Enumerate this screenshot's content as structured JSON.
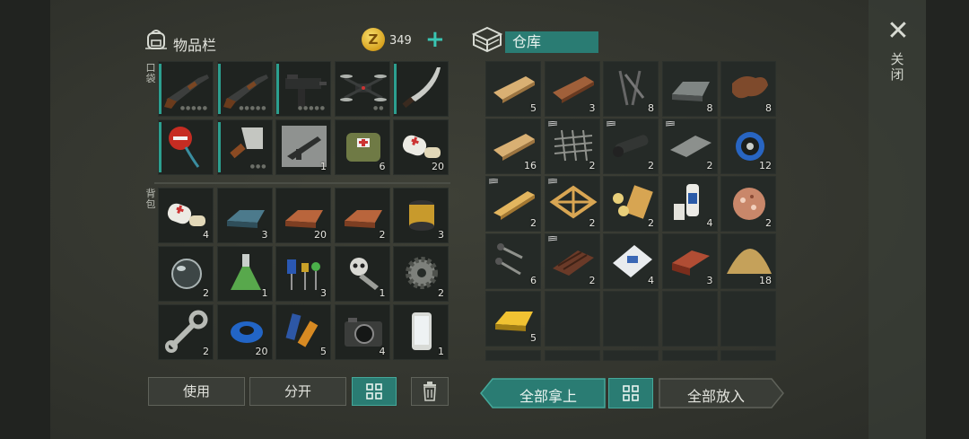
{
  "inventory": {
    "title": "物品栏",
    "coins": "349",
    "add_symbol": "+",
    "pocket_label": "口袋",
    "backpack_label": "背包",
    "pocket_items": [
      {
        "name": "pump-shotgun",
        "count": "",
        "durability": true,
        "dots": "●●●●●"
      },
      {
        "name": "pump-shotgun-2",
        "count": "",
        "durability": true,
        "dots": "●●●●●"
      },
      {
        "name": "uzi-smg",
        "count": "",
        "durability": true,
        "dots": "●●●●●"
      },
      {
        "name": "drone",
        "count": "",
        "durability": false,
        "dots": "●●"
      },
      {
        "name": "machete",
        "count": "",
        "durability": true,
        "dots": ""
      },
      {
        "name": "stop-sign-axe",
        "count": "",
        "durability": true,
        "dots": ""
      },
      {
        "name": "cleaver",
        "count": "",
        "durability": true,
        "dots": "●●●"
      },
      {
        "name": "rifle-blueprint",
        "count": "1",
        "durability": false,
        "dots": ""
      },
      {
        "name": "first-aid-backpack",
        "count": "6",
        "durability": false,
        "dots": ""
      },
      {
        "name": "bandage",
        "count": "20",
        "durability": false,
        "dots": ""
      }
    ],
    "backpack_items": [
      {
        "name": "bandage",
        "count": "4"
      },
      {
        "name": "steel-ingot",
        "count": "3"
      },
      {
        "name": "copper-ingot",
        "count": "20"
      },
      {
        "name": "copper-ingot",
        "count": "2"
      },
      {
        "name": "oil-filter",
        "count": "3"
      },
      {
        "name": "glass-lens",
        "count": "2"
      },
      {
        "name": "chemical-flask",
        "count": "1"
      },
      {
        "name": "capacitors",
        "count": "3"
      },
      {
        "name": "skull-mechanism",
        "count": "1"
      },
      {
        "name": "gear",
        "count": "2"
      },
      {
        "name": "wrench",
        "count": "2"
      },
      {
        "name": "duct-tape",
        "count": "20"
      },
      {
        "name": "batteries",
        "count": "5"
      },
      {
        "name": "camera",
        "count": "4"
      },
      {
        "name": "smartphone",
        "count": "1"
      }
    ]
  },
  "storage": {
    "title": "仓库",
    "items": [
      {
        "name": "plank",
        "count": "5",
        "blueprint": false
      },
      {
        "name": "dark-plank",
        "count": "3",
        "blueprint": false
      },
      {
        "name": "nails",
        "count": "8",
        "blueprint": false
      },
      {
        "name": "iron-ingot",
        "count": "8",
        "blueprint": false
      },
      {
        "name": "leather",
        "count": "8",
        "blueprint": false
      },
      {
        "name": "plank",
        "count": "16",
        "blueprint": false
      },
      {
        "name": "rebar-grid",
        "count": "2",
        "blueprint": true
      },
      {
        "name": "pipe",
        "count": "2",
        "blueprint": true
      },
      {
        "name": "metal-plate",
        "count": "2",
        "blueprint": true
      },
      {
        "name": "wire-spool",
        "count": "12",
        "blueprint": false
      },
      {
        "name": "beam",
        "count": "2",
        "blueprint": true
      },
      {
        "name": "wood-frame",
        "count": "2",
        "blueprint": true
      },
      {
        "name": "wood-bolts",
        "count": "2",
        "blueprint": false
      },
      {
        "name": "glue-bottles",
        "count": "4",
        "blueprint": false
      },
      {
        "name": "wood-shavings",
        "count": "2",
        "blueprint": false
      },
      {
        "name": "screws",
        "count": "6",
        "blueprint": false
      },
      {
        "name": "roof-tiles",
        "count": "2",
        "blueprint": true
      },
      {
        "name": "cement-bag",
        "count": "4",
        "blueprint": false
      },
      {
        "name": "brick",
        "count": "3",
        "blueprint": false
      },
      {
        "name": "sand-pile",
        "count": "18",
        "blueprint": false
      },
      {
        "name": "gold-ingot",
        "count": "5",
        "blueprint": false
      },
      {
        "name": "empty",
        "count": "",
        "blueprint": false
      },
      {
        "name": "empty",
        "count": "",
        "blueprint": false
      },
      {
        "name": "empty",
        "count": "",
        "blueprint": false
      },
      {
        "name": "empty",
        "count": "",
        "blueprint": false
      }
    ]
  },
  "buttons": {
    "use": "使用",
    "split": "分开",
    "take_all": "全部拿上",
    "put_all": "全部放入"
  },
  "close_label": "关闭",
  "colors": {
    "accent": "#2a7c73",
    "accent_light": "#39c5b2",
    "gold": "#d7a21f"
  }
}
